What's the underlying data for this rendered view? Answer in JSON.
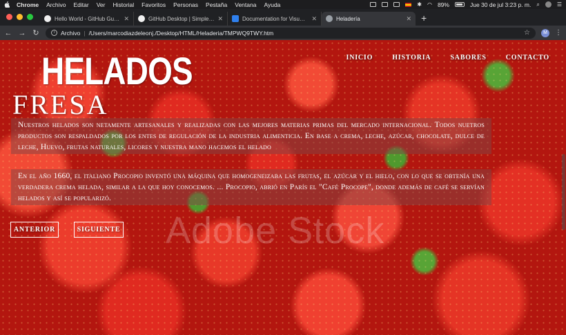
{
  "menubar": {
    "app": "Chrome",
    "items": [
      "Archivo",
      "Editar",
      "Ver",
      "Historial",
      "Favoritos",
      "Personas",
      "Pestaña",
      "Ventana",
      "Ayuda"
    ],
    "battery": "89%",
    "datetime": "Jue 30 de jul  3:23 p. m."
  },
  "tabs": [
    {
      "label": "Hello World - GitHub Guides",
      "icon": "github-icon"
    },
    {
      "label": "GitHub Desktop | Simple collab",
      "icon": "github-icon"
    },
    {
      "label": "Documentation for Visual Studi",
      "icon": "vscode-icon"
    },
    {
      "label": "Heladería",
      "icon": "globe-icon",
      "active": true
    }
  ],
  "toolbar": {
    "url_prefix": "Archivo",
    "url": "/Users/marcodiazdeleonj./Desktop/HTML/Heladeria/TMPWQ9TWY.htm",
    "profile_initial": "M"
  },
  "page": {
    "logo": "HELADOS",
    "nav": [
      "INICIO",
      "HISTORIA",
      "SABORES",
      "CONTACTO"
    ],
    "flavor": "FRESA",
    "paragraph1": "Nuestros helados son netamente artesanales y realizadas con las mejores materias primas del mercado internacional. Todos nuetros productos son respaldados por los entes de regulación de la industria alimenticia. En base a crema, leche, azúcar, chocolate, dulce de leche, Huevo, frutas naturales, licores y nuestra mano hacemos el helado",
    "paragraph2": "En el año 1660, el italiano Procopio inventó una máquina que homogeneizaba las frutas, el azúcar y el hielo, con lo que se obtenía una verdadera crema helada, similar a la que hoy conocemos. ... Procopio, abrió en París el \"Café Procope\", donde además de café se servían helados y así se popularizó.",
    "btn_prev": "ANTERIOR",
    "btn_next": "SIGUIENTE",
    "watermark": "Adobe Stock"
  },
  "colors": {
    "background_red": "#b3160f",
    "leaf_green": "#58a436",
    "text_panel": "rgba(130,70,70,0.5)"
  }
}
